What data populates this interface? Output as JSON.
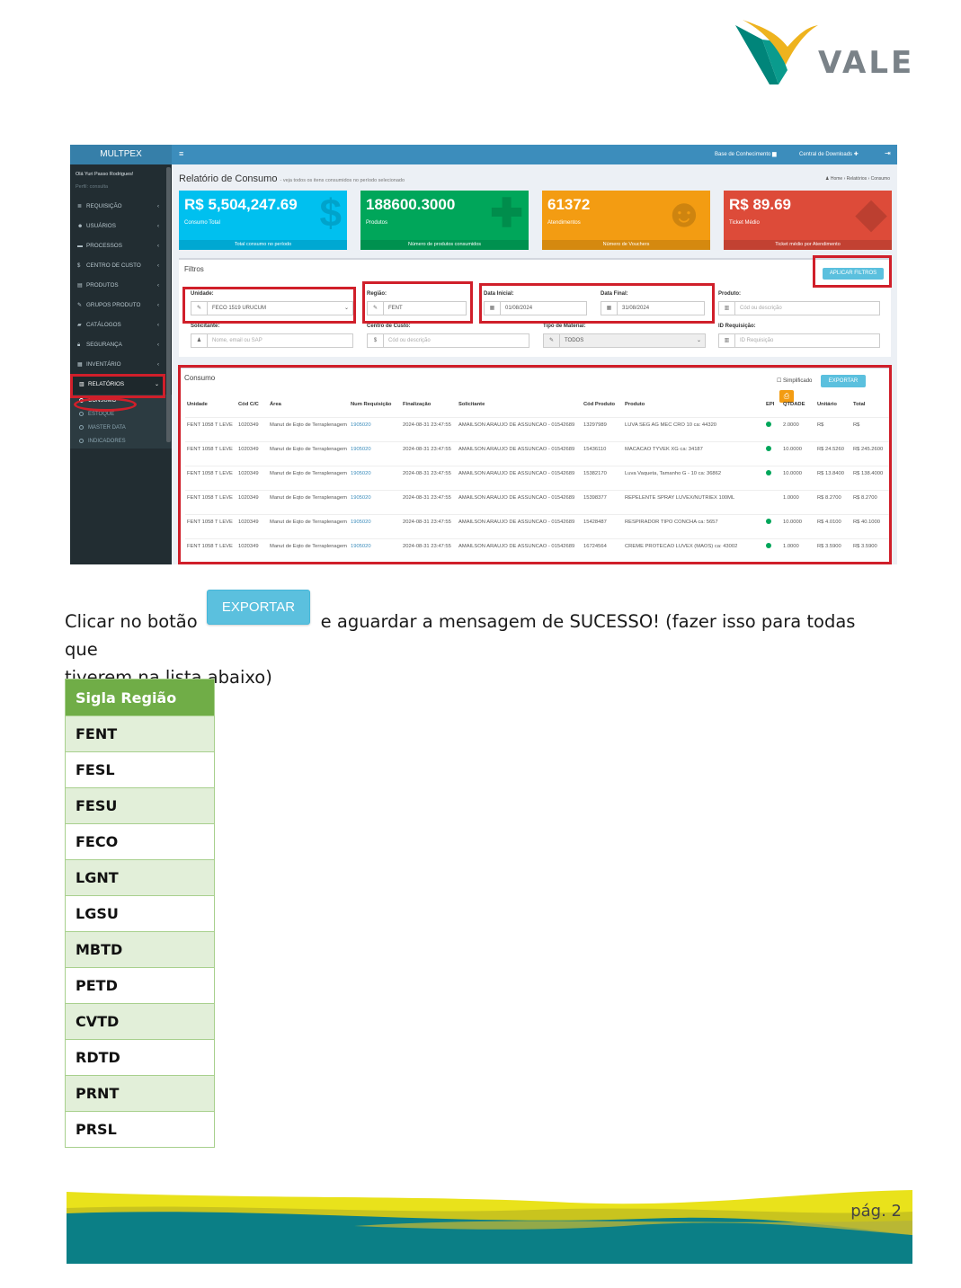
{
  "logo": {
    "text": "VALE",
    "colors": {
      "teal": "#00857a",
      "yellow": "#eeb31e",
      "gray": "#7a8288"
    }
  },
  "screenshot": {
    "brand": "MULTPEX",
    "user": "Olá Yuri Passo Rodrigues!",
    "profile": "Perfil: consulta",
    "nav": [
      {
        "icon": "≣",
        "label": "REQUISIÇÃO"
      },
      {
        "icon": "☻",
        "label": "USUÁRIOS"
      },
      {
        "icon": "▬",
        "label": "PROCESSOS"
      },
      {
        "icon": "$",
        "label": "CENTRO DE CUSTO"
      },
      {
        "icon": "▤",
        "label": "PRODUTOS"
      },
      {
        "icon": "✎",
        "label": "GRUPOS PRODUTO"
      },
      {
        "icon": "▰",
        "label": "CATÁLOGOS"
      },
      {
        "icon": "🔒︎",
        "label": "SEGURANÇA"
      },
      {
        "icon": "▦",
        "label": "INVENTÁRIO"
      },
      {
        "icon": "▥",
        "label": "RELATÓRIOS"
      }
    ],
    "submenu": [
      "CONSUMO",
      "ESTOQUE",
      "MASTER DATA",
      "INDICADORES"
    ],
    "topbar": {
      "menu_icon": "≡",
      "link1": "Base de Conhecimento ▆",
      "link2": "Central de Downloads ✚",
      "exit_icon": "⇥"
    },
    "title": "Relatório de Consumo",
    "subtitle": "- veja todos os itens consumidos no período selecionado",
    "breadcrumb": "♟ Home  ›  Relatórios  ›  Consumo",
    "kpis": [
      {
        "value": "R$ 5,504,247.69",
        "label": "Consumo Total",
        "footer": "Total consumo no período",
        "icon": "$",
        "color": "#00c0ef"
      },
      {
        "value": "188600.3000",
        "label": "Produtos",
        "footer": "Número de produtos consumidos",
        "icon": "✚",
        "color": "#00a65a"
      },
      {
        "value": "61372",
        "label": "Atendimentos",
        "footer": "Número de Vouchers",
        "icon": "☻",
        "color": "#f39c12"
      },
      {
        "value": "R$ 89.69",
        "label": "Ticket Médio",
        "footer": "Ticket médio por Atendimento",
        "icon": "◆",
        "color": "#dd4b39"
      }
    ],
    "filters": {
      "title": "Filtros",
      "apply_button": "APLICAR FILTROS",
      "unidade": {
        "label": "Unidade:",
        "value": "FECO 1519 URUCUM"
      },
      "regiao": {
        "label": "Região:",
        "value": "FENT"
      },
      "data_inicial": {
        "label": "Data Inicial:",
        "value": "01/08/2024"
      },
      "data_final": {
        "label": "Data Final:",
        "value": "31/08/2024"
      },
      "produto": {
        "label": "Produto:",
        "placeholder": "Cód ou descrição"
      },
      "solicitante": {
        "label": "Solicitante:",
        "placeholder": "Nome, email ou SAP"
      },
      "centro_custo": {
        "label": "Centro de Custo:",
        "placeholder": "Cód ou descrição"
      },
      "tipo_material": {
        "label": "Tipo de Material:",
        "value": "TODOS"
      },
      "id_requisicao": {
        "label": "ID Requisição:",
        "placeholder": "ID Requisição"
      }
    },
    "consumo": {
      "title": "Consumo",
      "simplificado": "Simplificado",
      "export_button": "EXPORTAR",
      "print_icon": "⎙",
      "columns": [
        "Unidade",
        "Cód C/C",
        "Área",
        "Num Requisição",
        "Finalização",
        "Solicitante",
        "Cód Produto",
        "Produto",
        "EPI",
        "QTDADE",
        "Unitário",
        "Total"
      ],
      "rows": [
        {
          "unidade": "FENT 1058 T LEVE",
          "cc": "1020349",
          "area": "Manut de Eqto de Terraplenagem",
          "req": "1905020",
          "fin": "2024-08-31 23:47:55",
          "sol": "AMAILSON ARAUJO DE ASSUNCAO - 01542689",
          "cod": "13297989",
          "prod": "LUVA SEG AG MEC CRO 10 ca: 44320",
          "epi": true,
          "qtd": "2.0000",
          "unit": "R$",
          "total": "R$"
        },
        {
          "unidade": "FENT 1058 T LEVE",
          "cc": "1020349",
          "area": "Manut de Eqto de Terraplenagem",
          "req": "1905020",
          "fin": "2024-08-31 23:47:55",
          "sol": "AMAILSON ARAUJO DE ASSUNCAO - 01542689",
          "cod": "15436110",
          "prod": "MACACAO TYVEK XG ca: 34187",
          "epi": true,
          "qtd": "10.0000",
          "unit": "R$ 24.5260",
          "total": "R$ 245.2600"
        },
        {
          "unidade": "FENT 1058 T LEVE",
          "cc": "1020349",
          "area": "Manut de Eqto de Terraplenagem",
          "req": "1905020",
          "fin": "2024-08-31 23:47:55",
          "sol": "AMAILSON ARAUJO DE ASSUNCAO - 01542689",
          "cod": "15382170",
          "prod": "Luva Vaqueta, Tamanho G - 10 ca: 36862",
          "epi": true,
          "qtd": "10.0000",
          "unit": "R$ 13.8400",
          "total": "R$ 138.4000"
        },
        {
          "unidade": "FENT 1058 T LEVE",
          "cc": "1020349",
          "area": "Manut de Eqto de Terraplenagem",
          "req": "1905020",
          "fin": "2024-08-31 23:47:55",
          "sol": "AMAILSON ARAUJO DE ASSUNCAO - 01542689",
          "cod": "15398377",
          "prod": "REPELENTE SPRAY LUVEX/NUTRIEX 100ML",
          "epi": false,
          "qtd": "1.0000",
          "unit": "R$ 8.2700",
          "total": "R$ 8.2700"
        },
        {
          "unidade": "FENT 1058 T LEVE",
          "cc": "1020349",
          "area": "Manut de Eqto de Terraplenagem",
          "req": "1905020",
          "fin": "2024-08-31 23:47:55",
          "sol": "AMAILSON ARAUJO DE ASSUNCAO - 01542689",
          "cod": "15428487",
          "prod": "RESPIRADOR TIPO CONCHA ca: 5657",
          "epi": true,
          "qtd": "10.0000",
          "unit": "R$ 4.0100",
          "total": "R$ 40.1000"
        },
        {
          "unidade": "FENT 1058 T LEVE",
          "cc": "1020349",
          "area": "Manut de Eqto de Terraplenagem",
          "req": "1905020",
          "fin": "2024-08-31 23:47:55",
          "sol": "AMAILSON ARAUJO DE ASSUNCAO - 01542689",
          "cod": "16724564",
          "prod": "CREME PROTECAO LUVEX (MAOS) ca: 43002",
          "epi": true,
          "qtd": "1.0000",
          "unit": "R$ 3.5900",
          "total": "R$ 3.5900"
        }
      ]
    }
  },
  "instruction": {
    "before": "Clicar no botão",
    "button": "EXPORTAR",
    "after": "e aguardar a mensagem de SUCESSO! (fazer isso para todas que",
    "line2": "tiverem na lista abaixo)"
  },
  "regions_table": {
    "header": "Sigla Região",
    "rows": [
      "FENT",
      "FESL",
      "FESU",
      "FECO",
      "LGNT",
      "LGSU",
      "MBTD",
      "PETD",
      "CVTD",
      "RDTD",
      "PRNT",
      "PRSL"
    ]
  },
  "footer": {
    "page": "pág. 2"
  }
}
